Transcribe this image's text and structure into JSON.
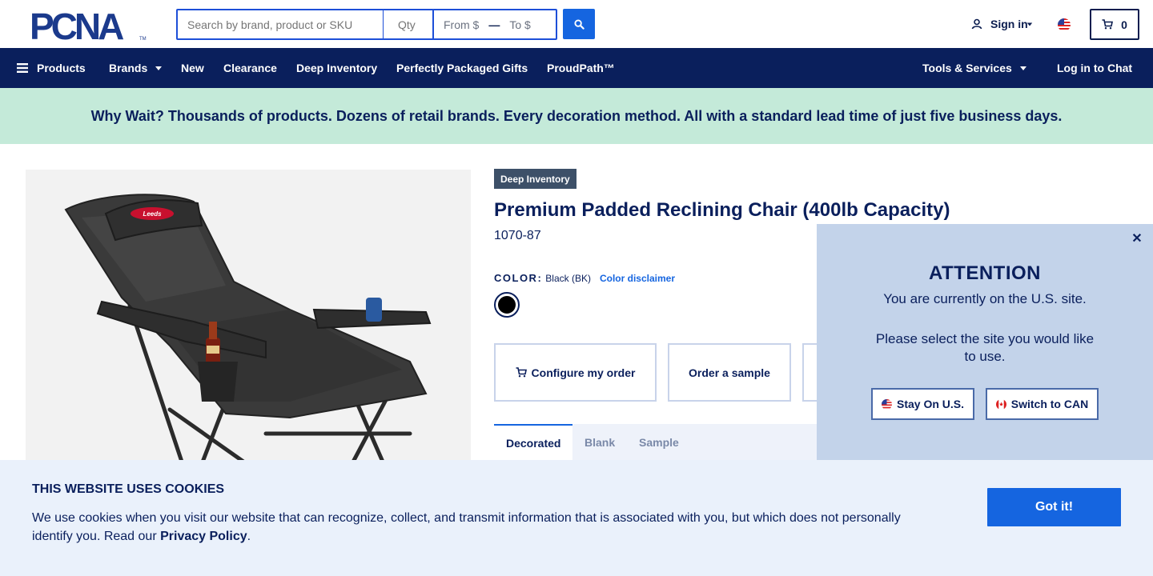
{
  "header": {
    "logo_text": "PCNA",
    "search_placeholder": "Search by brand, product or SKU",
    "qty_placeholder": "Qty",
    "price_from": "From $",
    "price_to": "To $",
    "signin_label": "Sign in",
    "cart_count": "0"
  },
  "nav": {
    "products": "Products",
    "brands": "Brands",
    "new": "New",
    "clearance": "Clearance",
    "deep_inventory": "Deep Inventory",
    "gifts": "Perfectly Packaged Gifts",
    "proudpath": "ProudPath™",
    "tools": "Tools & Services",
    "chat": "Log in to Chat"
  },
  "banner": {
    "text": "Why Wait? Thousands of products. Dozens of retail brands. Every decoration method. All with a standard lead time of just five business days."
  },
  "product": {
    "badge": "Deep Inventory",
    "title": "Premium Padded Reclining Chair (400lb Capacity)",
    "sku": "1070-87",
    "color_label": "COLOR:",
    "color_value": "Black (BK)",
    "color_disclaimer": "Color disclaimer",
    "swatch_color": "#000000",
    "image_logo_text": "Leeds"
  },
  "actions": {
    "configure": "Configure my order",
    "sample": "Order a sample"
  },
  "tabs": {
    "decorated": "Decorated",
    "blank": "Blank",
    "sample": "Sample"
  },
  "attention": {
    "title": "ATTENTION",
    "line1": "You are currently on the U.S. site.",
    "line2": "Please select the site you would like to use.",
    "stay": "Stay On U.S.",
    "switch": "Switch to CAN"
  },
  "cookie": {
    "title": "THIS WEBSITE USES COOKIES",
    "text_before": "We use cookies when you visit our website that can recognize, collect, and transmit information that is associated with you, but which does not personally identify you. Read our ",
    "privacy_link": "Privacy Policy",
    "text_after": ".",
    "button": "Got it!"
  },
  "colors": {
    "navy": "#0a1f5c",
    "accent_blue": "#1565e0",
    "banner_green": "#c4ead9",
    "modal_bg": "#c3d3ea",
    "cookie_bg": "#eaf1fb"
  }
}
